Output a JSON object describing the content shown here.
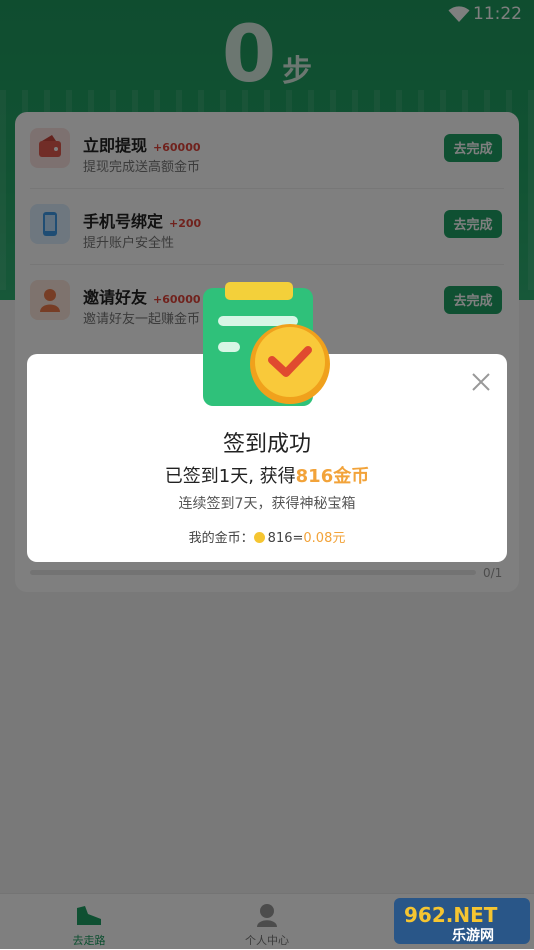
{
  "status_bar": {
    "time": "11:22"
  },
  "header": {
    "steps": "0",
    "unit": "步"
  },
  "tasks": [
    {
      "title": "立即提现",
      "reward": "+60000",
      "subtitle": "提现完成送高额金币",
      "button": "去完成",
      "icon": "wallet-icon"
    },
    {
      "title": "手机号绑定",
      "reward": "+200",
      "subtitle": "提升账户安全性",
      "button": "去完成",
      "icon": "phone-icon"
    },
    {
      "title": "邀请好友",
      "reward": "+60000",
      "subtitle": "邀请好友一起赚金币",
      "button": "去完成",
      "icon": "invite-icon"
    }
  ],
  "progress": {
    "count": "0/1",
    "fraction": 0
  },
  "dialog": {
    "title": "签到成功",
    "line1_prefix": "已签到1天, 获得",
    "line1_highlight": "816金币",
    "line2": "连续签到7天，获得神秘宝箱",
    "coins_label": "我的金币：",
    "coins_value": "816=",
    "coins_yuan": "0.08元"
  },
  "nav": {
    "items": [
      {
        "label": "去走路",
        "active": true
      },
      {
        "label": "个人中心",
        "active": false
      }
    ]
  },
  "watermark": {
    "text_top": "962.NET",
    "text_bottom": "乐游网"
  },
  "colors": {
    "brand_green": "#1ea064",
    "gold": "#f2a33a",
    "reward_red": "#e0443a"
  }
}
